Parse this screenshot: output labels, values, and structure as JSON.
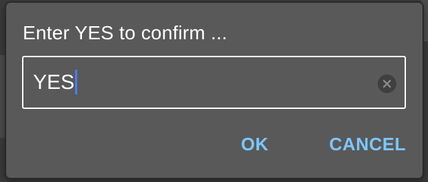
{
  "dialog": {
    "title": "Enter YES to confirm ...",
    "input": {
      "value": "YES"
    },
    "actions": {
      "ok_label": "OK",
      "cancel_label": "CANCEL"
    },
    "icons": {
      "clear": "clear-icon"
    }
  },
  "colors": {
    "dialog_bg": "#595959",
    "accent": "#7cc7ff",
    "caret": "#4a7dff"
  }
}
